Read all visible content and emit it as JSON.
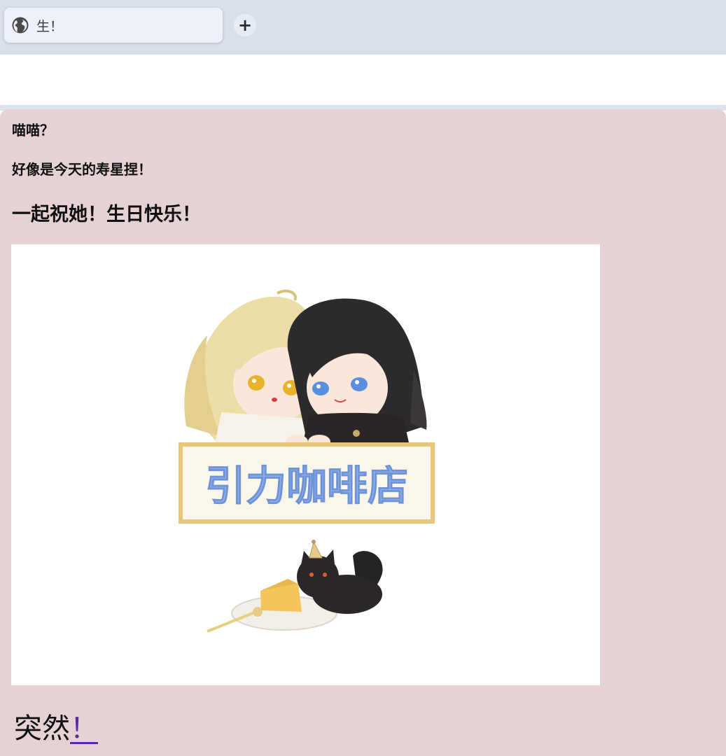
{
  "browser": {
    "tab_title": "生！",
    "tab_icon": "globe-icon",
    "new_tab_label": "+"
  },
  "post": {
    "line1": "喵喵？",
    "line2": "好像是今天的寿星捏！",
    "line3": "一起祝她！生日快乐！",
    "image": {
      "sign_text": "引力咖啡店"
    },
    "ending_text": "突然",
    "ending_link": "！"
  },
  "colors": {
    "page_background": "#e6d2d5",
    "tabbar_background": "#d8e1eb",
    "link_color": "#5a2aa8",
    "sign_text_color": "#8eb0ea",
    "sign_border_color": "#e8c77a"
  }
}
